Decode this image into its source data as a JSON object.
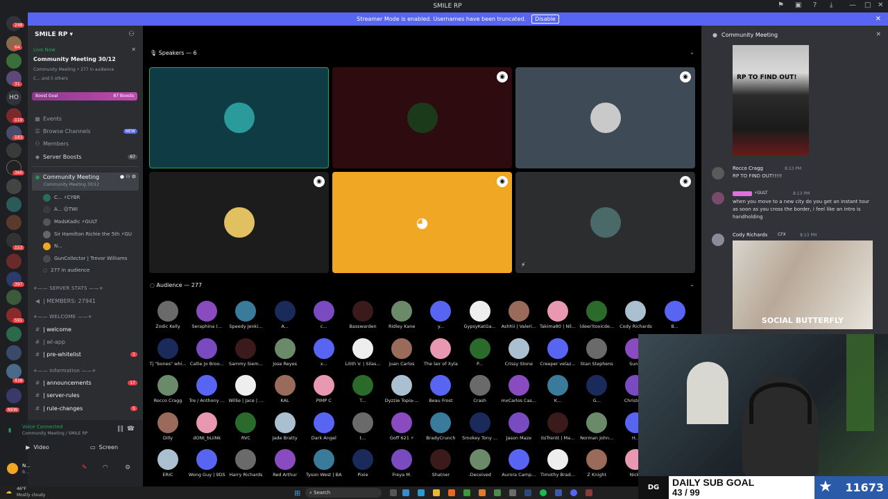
{
  "window": {
    "title": "SMILE RP"
  },
  "banner": {
    "text": "Streamer Mode is enabled. Usernames have been truncated.",
    "button": "Disable"
  },
  "guilds": {
    "badges": [
      "248",
      "64",
      "31",
      "110",
      "183",
      "360",
      "153",
      "397",
      "591",
      "438"
    ],
    "text_icon": "HO",
    "new_label": "NEW"
  },
  "server": {
    "name": "SMILE RP",
    "live_label": "Live Now",
    "event_title": "Community Meeting 30/12",
    "event_sub": "Community Meeting • 277 in audience",
    "event_people": "C... and 5 others",
    "boost_goal": "Boost Goal",
    "boost_count": "87 Boosts",
    "nav": [
      {
        "label": "Events",
        "icon": "calendar-icon",
        "badge": ""
      },
      {
        "label": "Browse Channels",
        "icon": "browse-icon",
        "badge": "NEW"
      },
      {
        "label": "Members",
        "icon": "members-icon",
        "badge": ""
      },
      {
        "label": "Server Boosts",
        "icon": "boost-icon",
        "badge": "67"
      }
    ],
    "stage_channel": {
      "name": "Community Meeting",
      "sub": "Community Meeting 30/12"
    },
    "stage_users": [
      "C... ⚡CYBR",
      "A... ☺TWI",
      "MadsKadic ⚡GULT",
      "Sir Hamilton Richie the 5th ⚡GU",
      "N...",
      "GunCollector | Trevor Williams"
    ],
    "audience_count": "277 in audience",
    "categories": [
      "SERVER STATS",
      "WELCOME",
      "Information"
    ],
    "channels": [
      {
        "name": "| MEMBERS: 27941",
        "badge": ""
      },
      {
        "name": "| welcome",
        "badge": ""
      },
      {
        "name": "| wl-app",
        "badge": ""
      },
      {
        "name": "| pre-whitelist",
        "badge": "1"
      },
      {
        "name": "| announcements",
        "badge": "17"
      },
      {
        "name": "| server-rules",
        "badge": ""
      },
      {
        "name": "| rule-changes",
        "badge": "5"
      }
    ]
  },
  "voice": {
    "status": "Voice Connected",
    "location": "Community Meeting / SMILE RP",
    "video_label": "Video",
    "screen_label": "Screen",
    "user_name": "N...",
    "user_status": "B..."
  },
  "stage": {
    "speakers_label": "Speakers — 6",
    "audience_label": "Audience — 277",
    "tiles_colors": [
      "#0f3b44",
      "#2e0b0f",
      "#3f4a57",
      "#1c1c1c",
      "#f0a723",
      "#2b2d2f"
    ],
    "audience": [
      [
        "Zodic Kelly",
        "Seraphina (...",
        "Speedy Jenki...",
        "A...",
        "c...",
        "Basswarden",
        "Ridley Kane",
        "y...",
        "GypsyKatGa...",
        "Ashhii | Valeri...",
        "Takima80 | Nil...",
        "(deer)toxicde...",
        "Cody Richards",
        "B..."
      ],
      [
        "Tj \"bones\" whi...",
        "Callie Jo Broo...",
        "Sammy Siem...",
        "Jose Reyes",
        "x...",
        "Lilith V. | Silas...",
        "Juan Carlos",
        "The lair of Xyla",
        "P...",
        "Crissy Stone",
        "Creeper velaz...",
        "Stan Stephens",
        "Sun..."
      ],
      [
        "Rocco Cragg",
        "Tre / Anthony ...",
        "Willie | Jace | ...",
        "KAL",
        "PIMP C",
        "T...",
        "Dyzzie Topia-...",
        "Beau Frost",
        "Crash",
        "mxCarlos Cas...",
        "K...",
        "G...",
        "Christop..."
      ],
      [
        "Dilly",
        "dONt_bLiiNk",
        "RVC",
        "Jade Bratty",
        "Dark Angel",
        "t...",
        "Goff 621 ⚡",
        "BradyCrunch",
        "Smokey Tony ...",
        "Jason Maze",
        "itsTrentt | Ma...",
        "Norman John...",
        "H..."
      ],
      [
        "ERIC",
        "Wong Guy | 9DS",
        "Harry Richards",
        "Red Arthur",
        "Tyson West | BA",
        "Pixie",
        "Freya M.",
        "Shatner",
        "-Deceived",
        "Aurora Camp...",
        "Timothy Brad...",
        "Z Knight",
        "Nicky"
      ]
    ]
  },
  "chat": {
    "title": "Community Meeting",
    "image_caption": "RP TO FIND OUT!",
    "messages": [
      {
        "author": "Rocco Cragg",
        "time": "8:13 PM",
        "text": "RP TO FIND OUT!!!!!"
      },
      {
        "author": "",
        "tag": "⚡GULT",
        "time": "8:13 PM",
        "text": "when you move to a new city do you get an instant tour as soon as you cross the border, i feel like an intro is handholding"
      },
      {
        "author": "Cody Richards",
        "tag": "CFX",
        "time": "8:13 PM",
        "text": ""
      }
    ],
    "gif_caption": "SOCIAL BUTTERFLY"
  },
  "overlay": {
    "sub_goal_title": "DAILY SUB GOAL",
    "sub_goal_progress": "43 / 99",
    "sub_count": "11673",
    "logo": "DG"
  },
  "taskbar": {
    "weather_temp": "46°F",
    "weather_desc": "Mostly cloudy",
    "search": "Search"
  }
}
